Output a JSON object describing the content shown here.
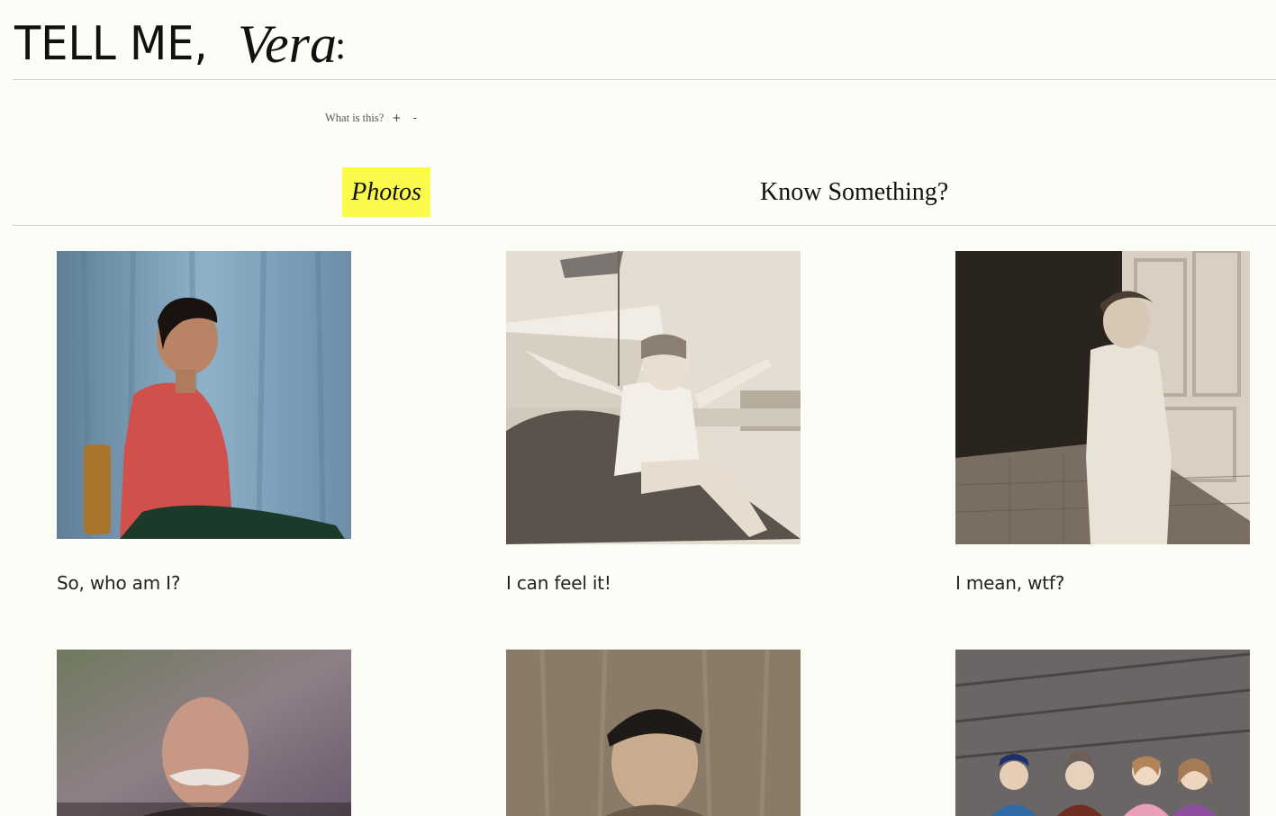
{
  "header": {
    "logo_main": "TELL ME,",
    "logo_name": "Vera",
    "logo_punct": ":"
  },
  "info": {
    "label": "What is this?",
    "expand": "+",
    "collapse": "-"
  },
  "tabs": [
    {
      "label": "Photos",
      "active": true
    },
    {
      "label": "Know Something?",
      "active": false
    }
  ],
  "photos": [
    {
      "caption": "So, who am I?"
    },
    {
      "caption": "I can feel it!"
    },
    {
      "caption": "I mean, wtf?"
    },
    {
      "caption": ""
    },
    {
      "caption": ""
    },
    {
      "caption": ""
    }
  ],
  "colors": {
    "background": "#fdfdf8",
    "active_tab": "#fafa4b",
    "divider": "#cfcfcf"
  }
}
